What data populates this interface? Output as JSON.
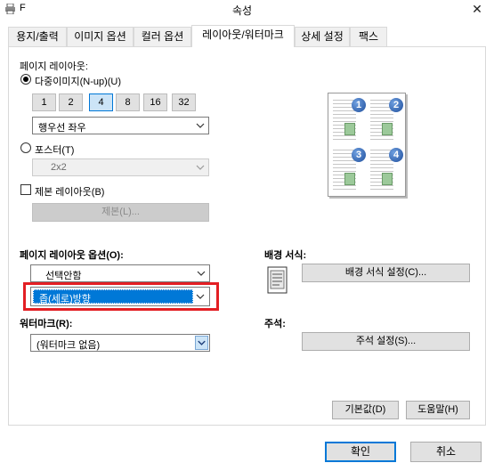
{
  "window": {
    "title": "속성",
    "title_prefix": "F",
    "close_label": "✕"
  },
  "tabs": [
    {
      "label": "용지/출력",
      "active": false
    },
    {
      "label": "이미지 옵션",
      "active": false
    },
    {
      "label": "컬러 옵션",
      "active": false
    },
    {
      "label": "레이아웃/워터마크",
      "active": true
    },
    {
      "label": "상세 설정",
      "active": false
    },
    {
      "label": "팩스",
      "active": false
    }
  ],
  "page_layout": {
    "group_label": "페이지 레이아웃:",
    "nup_label": "다중이미지(N-up)(U)",
    "nup_selected": true,
    "nup_buttons": [
      "1",
      "2",
      "4",
      "8",
      "16",
      "32"
    ],
    "nup_active": "4",
    "order_value": "행우선 좌우",
    "poster_label": "포스터(T)",
    "poster_value": "2x2",
    "booklet_label": "제본 레이아웃(B)",
    "booklet_button": "제본(L)..."
  },
  "preview": {
    "numbers": [
      "1",
      "2",
      "3",
      "4"
    ]
  },
  "layout_options": {
    "label": "페이지 레이아웃 옵션(O):",
    "value": "선택안함",
    "orientation_value": "좁(세로)방향"
  },
  "watermark": {
    "label": "워터마크(R):",
    "value": "(워터마크 없음)"
  },
  "background": {
    "label": "배경 서식:",
    "button": "배경 서식 설정(C)..."
  },
  "annotation": {
    "label": "주석:",
    "button": "주석 설정(S)..."
  },
  "bottom": {
    "defaults_button": "기본값(D)",
    "help_button": "도움말(H)",
    "ok_button": "확인",
    "cancel_button": "취소"
  },
  "colors": {
    "highlight_box": "#e31f24",
    "selection": "#0078d7"
  }
}
